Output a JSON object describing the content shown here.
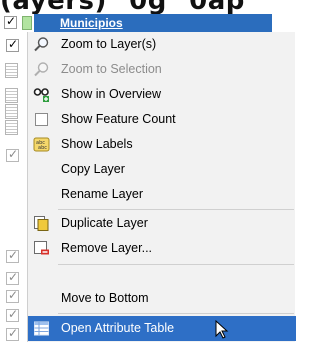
{
  "background_text": "(ayers)^0g^0ap",
  "layer": {
    "name": "Municipios",
    "visible": true,
    "swatch_color": "#b2e4a0"
  },
  "tree_left_column": [
    {
      "type": "checkbox",
      "checked": true
    },
    {
      "type": "table-icon"
    },
    {
      "type": "table-icon"
    },
    {
      "type": "table-icon"
    },
    {
      "type": "table-icon"
    },
    {
      "type": "checkbox",
      "checked": true,
      "greyed": true
    },
    {
      "type": "checkbox",
      "checked": true,
      "greyed": true
    },
    {
      "type": "checkbox",
      "checked": true,
      "greyed": true
    },
    {
      "type": "checkbox",
      "checked": true,
      "greyed": true
    },
    {
      "type": "checkbox",
      "checked": true,
      "greyed": true
    }
  ],
  "menu": {
    "items": [
      {
        "label": "Zoom to Layer(s)",
        "icon": "magnifier-icon",
        "enabled": true
      },
      {
        "label": "Zoom to Selection",
        "icon": "magnifier-icon",
        "enabled": false
      },
      {
        "label": "Show in Overview",
        "icon": "overview-glasses-icon",
        "enabled": true
      },
      {
        "label": "Show Feature Count",
        "icon": "checkbox-icon",
        "enabled": true
      },
      {
        "label": "Show Labels",
        "icon": "labels-icon",
        "enabled": true
      },
      {
        "label": "Copy Layer",
        "icon": "",
        "enabled": true
      },
      {
        "label": "Rename Layer",
        "icon": "",
        "enabled": true
      },
      {
        "label": "Duplicate Layer",
        "icon": "duplicate-layer-icon",
        "enabled": true
      },
      {
        "label": "Remove Layer...",
        "icon": "remove-layer-icon",
        "enabled": true
      },
      {
        "label": "Move to Bottom",
        "icon": "",
        "enabled": true
      },
      {
        "label": "Open Attribute Table",
        "icon": "attribute-table-icon",
        "enabled": true,
        "highlighted": true
      }
    ]
  },
  "colors": {
    "highlight": "#2e6fc6",
    "layer_selected": "#2b6dbd",
    "menu_bg": "#f2f2f2"
  }
}
